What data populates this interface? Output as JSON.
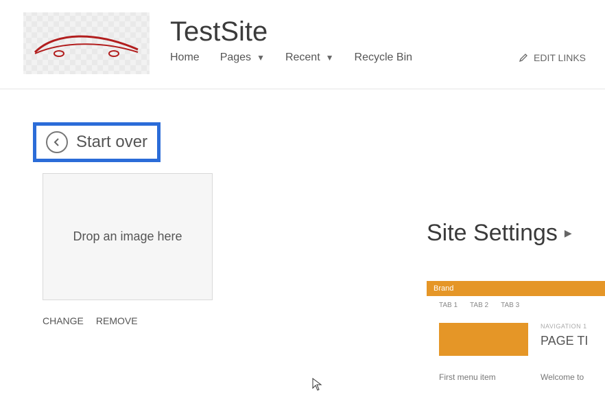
{
  "header": {
    "site_title": "TestSite",
    "nav": {
      "home": "Home",
      "pages": "Pages",
      "recent": "Recent",
      "recycle": "Recycle Bin",
      "edit_links": "EDIT LINKS"
    }
  },
  "main": {
    "start_over": "Start over",
    "drop_image": "Drop an image here",
    "change": "CHANGE",
    "remove": "REMOVE"
  },
  "right": {
    "title": "Site Settings",
    "preview": {
      "brand": "Brand",
      "tabs": [
        "TAB 1",
        "TAB 2",
        "TAB 3"
      ],
      "nav_label": "NAVIGATION 1",
      "page_title": "PAGE TI",
      "menu_first": "First menu item",
      "welcome": "Welcome to"
    }
  },
  "colors": {
    "accent_orange": "#e59627",
    "highlight_blue": "#2b6cd8"
  }
}
